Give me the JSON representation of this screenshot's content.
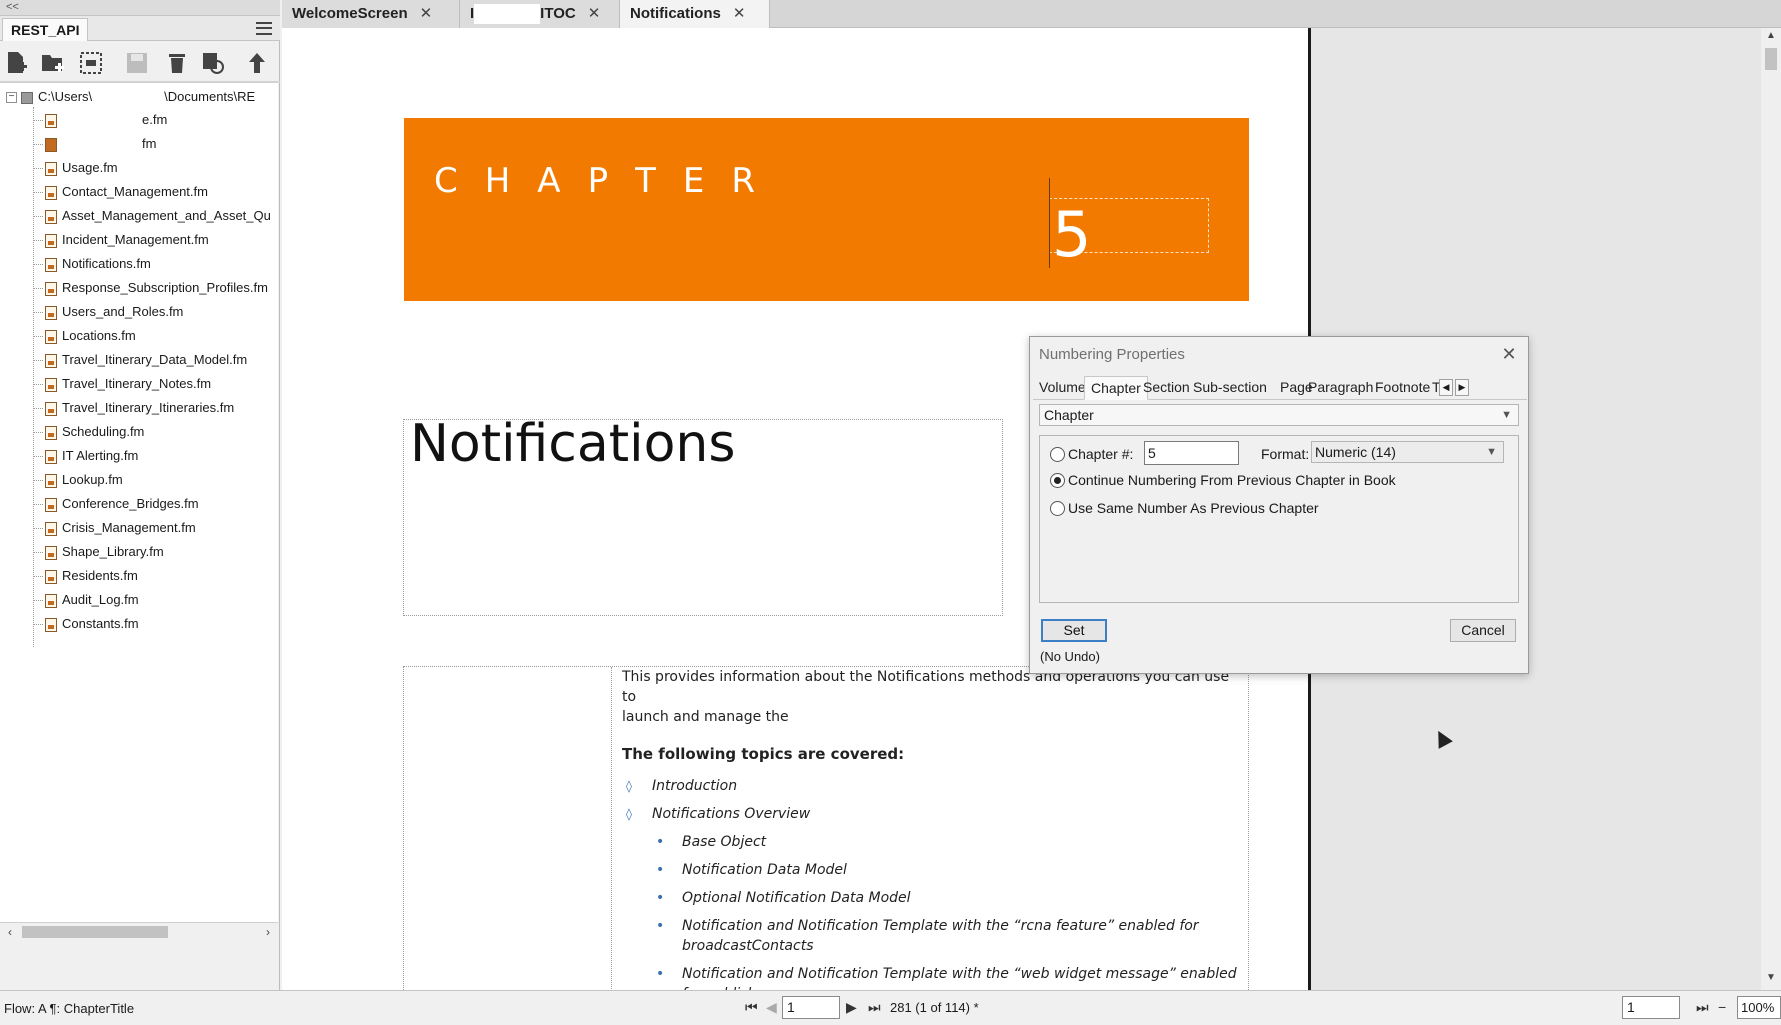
{
  "panel": {
    "collapse_glyph": "<<",
    "book_tab": "REST_API",
    "toolbar_icons": [
      "add-file-icon",
      "add-folder-icon",
      "add-group-icon",
      "save-icon",
      "delete-icon",
      "update-icon",
      "move-up-icon"
    ],
    "root_path_left": "C:\\Users\\",
    "root_path_right": "\\Documents\\RE",
    "items": [
      {
        "label": "e.fm",
        "redacted": true
      },
      {
        "label": "fm",
        "redacted": true
      },
      {
        "label": "Usage.fm"
      },
      {
        "label": "Contact_Management.fm"
      },
      {
        "label": "Asset_Management_and_Asset_Qu"
      },
      {
        "label": "Incident_Management.fm"
      },
      {
        "label": "Notifications.fm"
      },
      {
        "label": "Response_Subscription_Profiles.fm"
      },
      {
        "label": "Users_and_Roles.fm"
      },
      {
        "label": "Locations.fm"
      },
      {
        "label": "Travel_Itinerary_Data_Model.fm"
      },
      {
        "label": "Travel_Itinerary_Notes.fm"
      },
      {
        "label": "Travel_Itinerary_Itineraries.fm"
      },
      {
        "label": "Scheduling.fm"
      },
      {
        "label": "IT Alerting.fm"
      },
      {
        "label": "Lookup.fm"
      },
      {
        "label": "Conference_Bridges.fm"
      },
      {
        "label": "Crisis_Management.fm"
      },
      {
        "label": "Shape_Library.fm"
      },
      {
        "label": "Residents.fm"
      },
      {
        "label": "Audit_Log.fm"
      },
      {
        "label": "Constants.fm"
      }
    ]
  },
  "doc_tabs": [
    {
      "label": "WelcomeScreen",
      "close": "✕"
    },
    {
      "label_prefix": "I",
      "label": "ITOC",
      "close": "✕"
    },
    {
      "label": "Notifications",
      "close": "✕"
    }
  ],
  "document": {
    "chapter_word": "CHAPTER",
    "chapter_number": "5",
    "title": "Notifications",
    "intro_line1": "This provides information about the Notifications methods and operations you can use to",
    "intro_line2": "launch and manage the",
    "topics_heading": "The following topics are covered:",
    "topics": [
      {
        "level": 1,
        "marker": "◊",
        "text": "Introduction"
      },
      {
        "level": 1,
        "marker": "◊",
        "text": "Notifications Overview"
      },
      {
        "level": 2,
        "marker": "•",
        "text": "Base Object"
      },
      {
        "level": 2,
        "marker": "•",
        "text": "Notification Data Model"
      },
      {
        "level": 2,
        "marker": "•",
        "text": "Optional Notification Data Model"
      },
      {
        "level": 2,
        "marker": "•",
        "text": "Notification and Notification Template with the “rcna feature” enabled for broadcastContacts"
      },
      {
        "level": 2,
        "marker": "•",
        "text": "Notification and Notification Template with the “web widget message” enabled for publish message"
      }
    ]
  },
  "dialog": {
    "title": "Numbering Properties",
    "close": "✕",
    "tabs": [
      "Volume",
      "Chapter",
      "Section",
      "Sub-section",
      "Page",
      "Paragraph",
      "Footnote",
      "T"
    ],
    "active_tab": "Chapter",
    "selector_value": "Chapter",
    "options": {
      "chapter_num_label": "Chapter #:",
      "chapter_num_value": "5",
      "format_label": "Format:",
      "format_value": "Numeric (14)",
      "continue_label": "Continue Numbering From Previous Chapter in Book",
      "same_label": "Use Same Number As Previous Chapter",
      "selected": "continue"
    },
    "set_button": "Set",
    "cancel_button": "Cancel",
    "no_undo": "(No Undo)"
  },
  "status": {
    "flow": "Flow: A  ¶: ChapterTitle",
    "page_value": "1",
    "page_count": "281 (1 of 114) *",
    "zoom_page_value": "1",
    "zoom": "100%"
  },
  "colors": {
    "chapter_banner": "#f37a00",
    "bullet": "#3a6fb0"
  }
}
